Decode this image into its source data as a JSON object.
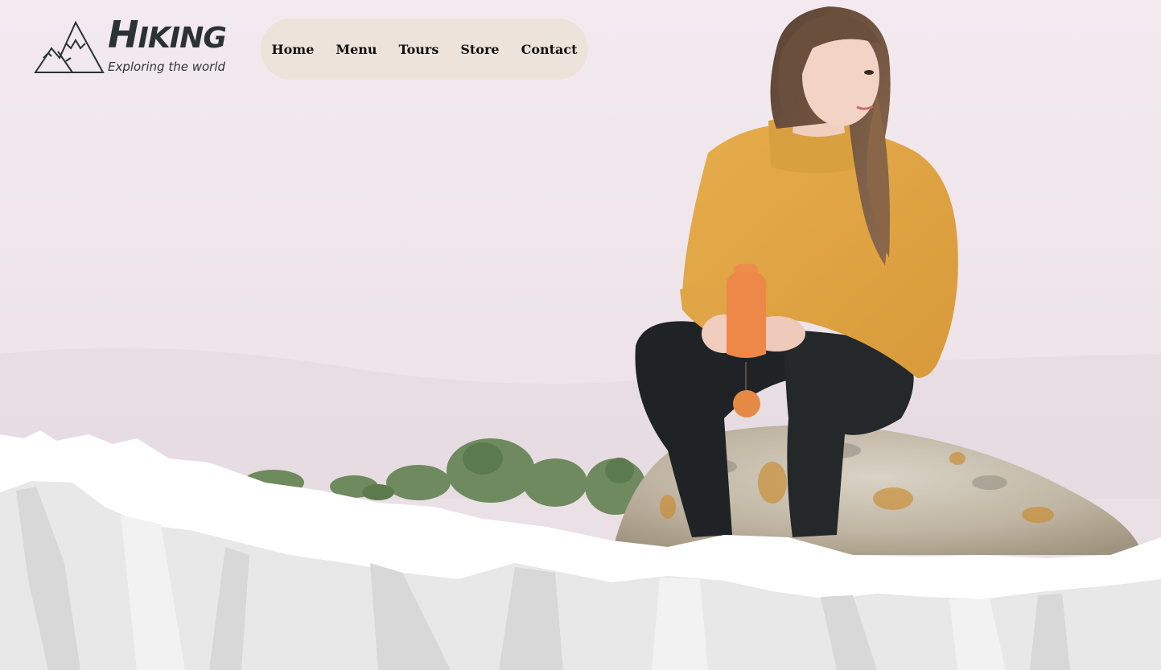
{
  "brand": {
    "logo_icon": "mountains-icon",
    "title_first": "H",
    "title_rest": "IKING",
    "subtitle": "Exploring the world",
    "text_color": "#2a3233"
  },
  "nav": {
    "background": "#ede3db",
    "items": [
      {
        "label": "Home"
      },
      {
        "label": "Menu"
      },
      {
        "label": "Tours"
      },
      {
        "label": "Store"
      },
      {
        "label": "Contact"
      }
    ]
  },
  "hero": {
    "image": "woman-sitting-on-rock-photo",
    "sweater_color": "#e2a845",
    "bottle_color": "#ef8c4d",
    "bottom_edge": "torn-paper-edge"
  }
}
